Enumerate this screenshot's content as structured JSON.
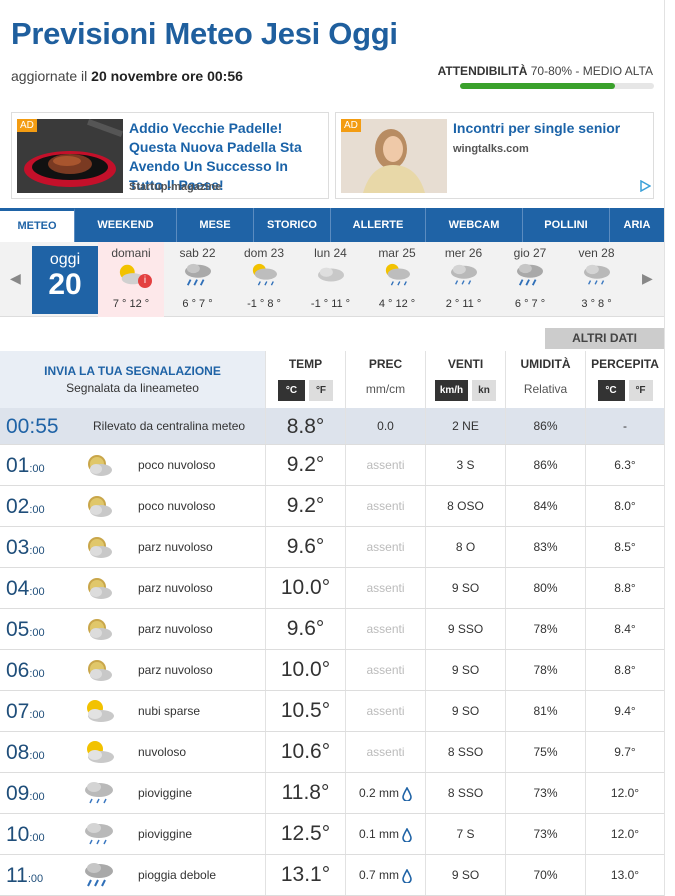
{
  "header": {
    "title": "Previsioni Meteo Jesi Oggi",
    "updated_prefix": "aggiornate il ",
    "updated_date": "20 novembre ore 00:56",
    "reliability_label": "ATTENDIBILITÀ",
    "reliability_value": "70-80% - MEDIO ALTA",
    "reliability_fraction": 0.8
  },
  "ads": [
    {
      "tag": "AD",
      "title": "Addio Vecchie Padelle! Questa Nuova Padella Sta Avendo Un Successo In Tutto Il Paese!",
      "source": "Startup-magazine"
    },
    {
      "tag": "AD",
      "title": "Incontri per single senior",
      "source": "wingtalks.com"
    }
  ],
  "nav": [
    "METEO",
    "WEEKEND",
    "MESE",
    "STORICO",
    "ALLERTE",
    "WEBCAM",
    "POLLINI",
    "ARIA"
  ],
  "today": {
    "label": "oggi",
    "day": "20"
  },
  "days": [
    {
      "name": "domani",
      "temps": "7 ° 12 °",
      "icon": "partly-cloudy-icon",
      "info": "i"
    },
    {
      "name": "sab 22",
      "temps": "6 ° 7 °",
      "icon": "rain-icon"
    },
    {
      "name": "dom 23",
      "temps": "-1 ° 8 °",
      "icon": "sun-rain-icon"
    },
    {
      "name": "lun 24",
      "temps": "-1 ° 11 °",
      "icon": "cloudy-icon"
    },
    {
      "name": "mar 25",
      "temps": "4 ° 12 °",
      "icon": "sun-rain-icon"
    },
    {
      "name": "mer 26",
      "temps": "2 ° 11 °",
      "icon": "drizzle-icon"
    },
    {
      "name": "gio 27",
      "temps": "6 ° 7 °",
      "icon": "rain-icon"
    },
    {
      "name": "ven 28",
      "temps": "3 ° 8 °",
      "icon": "drizzle-icon"
    }
  ],
  "altri_dati": "ALTRI DATI",
  "table_header": {
    "report_title": "INVIA LA TUA SEGNALAZIONE",
    "report_sub": "Segnalata da lineameteo",
    "temp": "TEMP",
    "temp_c": "°C",
    "temp_f": "°F",
    "prec": "PREC",
    "prec_unit": "mm/cm",
    "wind": "VENTI",
    "wind_kmh": "km/h",
    "wind_kn": "kn",
    "hum": "UMIDITÀ",
    "hum_sub": "Relativa",
    "perc": "PERCEPITA",
    "perc_c": "°C",
    "perc_f": "°F"
  },
  "current": {
    "time": "00:55",
    "desc": "Rilevato da centralina meteo",
    "temp": "8.8°",
    "prec": "0.0",
    "wind": "2  NE",
    "hum": "86%",
    "perc": "-"
  },
  "hours": [
    {
      "h": "01",
      "m": ":00",
      "icon": "moon-cloud-icon",
      "desc": "poco nuvoloso",
      "temp": "9.2°",
      "prec": "assenti",
      "wind": "3  S",
      "hum": "86%",
      "perc": "6.3°"
    },
    {
      "h": "02",
      "m": ":00",
      "icon": "moon-cloud-icon",
      "desc": "poco nuvoloso",
      "temp": "9.2°",
      "prec": "assenti",
      "wind": "8  OSO",
      "hum": "84%",
      "perc": "8.0°"
    },
    {
      "h": "03",
      "m": ":00",
      "icon": "moon-cloud-icon",
      "desc": "parz nuvoloso",
      "temp": "9.6°",
      "prec": "assenti",
      "wind": "8  O",
      "hum": "83%",
      "perc": "8.5°"
    },
    {
      "h": "04",
      "m": ":00",
      "icon": "moon-cloud-icon",
      "desc": "parz nuvoloso",
      "temp": "10.0°",
      "prec": "assenti",
      "wind": "9  SO",
      "hum": "80%",
      "perc": "8.8°"
    },
    {
      "h": "05",
      "m": ":00",
      "icon": "moon-cloud-icon",
      "desc": "parz nuvoloso",
      "temp": "9.6°",
      "prec": "assenti",
      "wind": "9  SSO",
      "hum": "78%",
      "perc": "8.4°"
    },
    {
      "h": "06",
      "m": ":00",
      "icon": "moon-cloud-icon",
      "desc": "parz nuvoloso",
      "temp": "10.0°",
      "prec": "assenti",
      "wind": "9  SO",
      "hum": "78%",
      "perc": "8.8°"
    },
    {
      "h": "07",
      "m": ":00",
      "icon": "sun-cloud-icon",
      "desc": "nubi sparse",
      "temp": "10.5°",
      "prec": "assenti",
      "wind": "9  SO",
      "hum": "81%",
      "perc": "9.4°"
    },
    {
      "h": "08",
      "m": ":00",
      "icon": "sun-cloud-icon",
      "desc": "nuvoloso",
      "temp": "10.6°",
      "prec": "assenti",
      "wind": "8  SSO",
      "hum": "75%",
      "perc": "9.7°"
    },
    {
      "h": "09",
      "m": ":00",
      "icon": "drizzle-icon",
      "desc": "pioviggine",
      "temp": "11.8°",
      "prec": "0.2 mm",
      "wind": "8  SSO",
      "hum": "73%",
      "perc": "12.0°"
    },
    {
      "h": "10",
      "m": ":00",
      "icon": "drizzle-icon",
      "desc": "pioviggine",
      "temp": "12.5°",
      "prec": "0.1 mm",
      "wind": "7  S",
      "hum": "73%",
      "perc": "12.0°"
    },
    {
      "h": "11",
      "m": ":00",
      "icon": "rain-icon",
      "desc": "pioggia debole",
      "temp": "13.1°",
      "prec": "0.7 mm",
      "wind": "9  SO",
      "hum": "70%",
      "perc": "13.0°"
    }
  ],
  "colors": {
    "brand": "#1f63a6",
    "accent_green": "#3aa12b"
  }
}
